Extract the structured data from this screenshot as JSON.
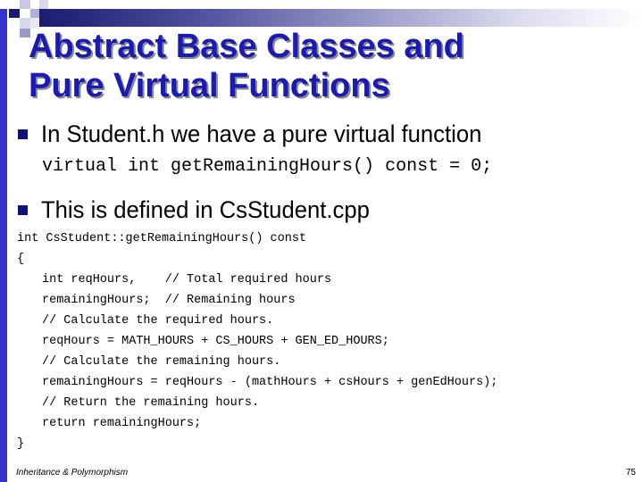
{
  "slide": {
    "title_line1": "Abstract Base Classes and",
    "title_line2": "Pure Virtual Functions",
    "bullets": [
      {
        "text": "In Student.h we have a pure virtual function"
      },
      {
        "text": "This is defined in CsStudent.cpp"
      }
    ],
    "declaration": "virtual int getRemainingHours() const = 0;",
    "code": {
      "signature": "int CsStudent::getRemainingHours() const",
      "open_brace": "{",
      "body": [
        "int reqHours,    // Total required hours",
        "remainingHours;  // Remaining hours",
        "// Calculate the required hours.",
        "reqHours = MATH_HOURS + CS_HOURS + GEN_ED_HOURS;",
        "// Calculate the remaining hours.",
        "remainingHours = reqHours - (mathHours + csHours + genEdHours);",
        "// Return the remaining hours.",
        "return remainingHours;"
      ],
      "close_brace": "}"
    },
    "footer": {
      "left": "Inheritance & Polymorphism",
      "page_number": "75"
    }
  }
}
